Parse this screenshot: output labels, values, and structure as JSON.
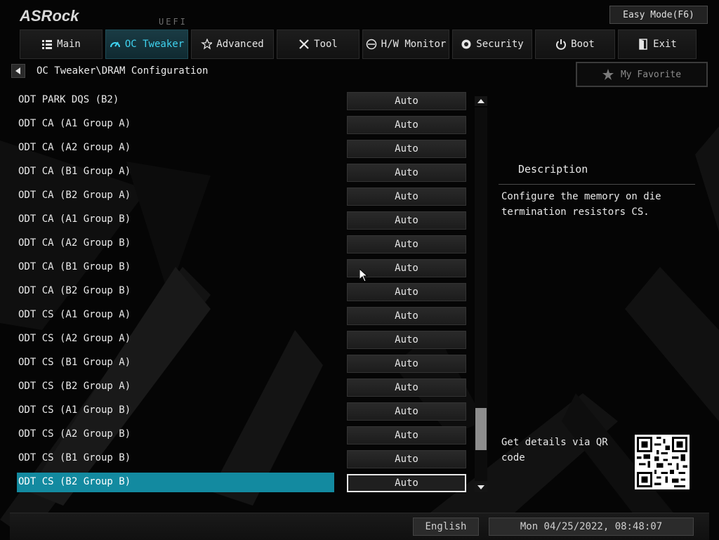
{
  "brand": {
    "logo_text": "ASRock",
    "uefi_label": "UEFI"
  },
  "header": {
    "easy_mode_label": "Easy Mode(F6)"
  },
  "nav": {
    "tabs": [
      {
        "label": "Main",
        "icon": "list-icon"
      },
      {
        "label": "OC Tweaker",
        "icon": "speed-icon",
        "active": true
      },
      {
        "label": "Advanced",
        "icon": "star-swoosh-icon"
      },
      {
        "label": "Tool",
        "icon": "tools-icon"
      },
      {
        "label": "H/W Monitor",
        "icon": "monitor-dial-icon"
      },
      {
        "label": "Security",
        "icon": "shield-icon"
      },
      {
        "label": "Boot",
        "icon": "power-icon"
      },
      {
        "label": "Exit",
        "icon": "exit-door-icon"
      }
    ]
  },
  "breadcrumb": {
    "path": "OC Tweaker\\DRAM Configuration"
  },
  "favorite": {
    "label": "My Favorite"
  },
  "settings": [
    {
      "label": "ODT PARK DQS (B2)",
      "value": "Auto"
    },
    {
      "label": "ODT CA (A1 Group A)",
      "value": "Auto"
    },
    {
      "label": "ODT CA (A2 Group A)",
      "value": "Auto"
    },
    {
      "label": "ODT CA (B1 Group A)",
      "value": "Auto"
    },
    {
      "label": "ODT CA (B2 Group A)",
      "value": "Auto"
    },
    {
      "label": "ODT CA (A1 Group B)",
      "value": "Auto"
    },
    {
      "label": "ODT CA (A2 Group B)",
      "value": "Auto"
    },
    {
      "label": "ODT CA (B1 Group B)",
      "value": "Auto"
    },
    {
      "label": "ODT CA (B2 Group B)",
      "value": "Auto"
    },
    {
      "label": "ODT CS (A1 Group A)",
      "value": "Auto"
    },
    {
      "label": "ODT CS (A2 Group A)",
      "value": "Auto"
    },
    {
      "label": "ODT CS (B1 Group A)",
      "value": "Auto"
    },
    {
      "label": "ODT CS (B2 Group A)",
      "value": "Auto"
    },
    {
      "label": "ODT CS (A1 Group B)",
      "value": "Auto"
    },
    {
      "label": "ODT CS (A2 Group B)",
      "value": "Auto"
    },
    {
      "label": "ODT CS (B1 Group B)",
      "value": "Auto"
    },
    {
      "label": "ODT CS (B2 Group B)",
      "value": "Auto",
      "selected": true
    }
  ],
  "scrollbar": {
    "position_fraction": 0.8
  },
  "description": {
    "title": "Description",
    "text": "Configure the memory on die termination resistors CS."
  },
  "qr": {
    "text": "Get details via QR code"
  },
  "footer": {
    "language": "English",
    "datetime": "Mon 04/25/2022, 08:48:07"
  },
  "colors": {
    "accent": "#138aa0",
    "active_tab_text": "#3fd3f0",
    "background": "#050505"
  }
}
